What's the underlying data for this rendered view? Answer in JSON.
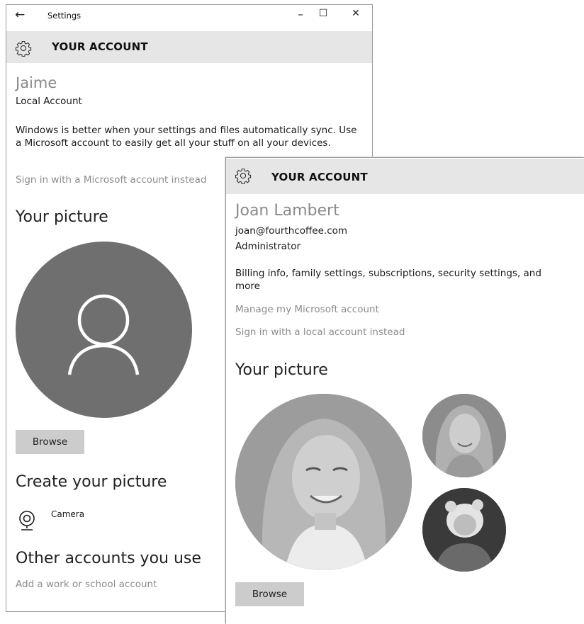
{
  "window1": {
    "app_title": "Settings",
    "back_glyph": "←",
    "minimize_glyph": "–",
    "maximize_glyph": "☐",
    "close_glyph": "✕",
    "header_title": "YOUR ACCOUNT",
    "user_name": "Jaime",
    "account_type": "Local Account",
    "sync_message": "Windows is better when your settings and files automatically sync. Use a Microsoft account to easily get all your stuff on all your devices.",
    "sign_in_link": "Sign in with a Microsoft account instead",
    "your_picture_heading": "Your picture",
    "browse_label": "Browse",
    "create_picture_heading": "Create your picture",
    "camera_label": "Camera",
    "other_accounts_heading": "Other accounts you use",
    "add_account_link": "Add a work or school account"
  },
  "window2": {
    "header_title": "YOUR ACCOUNT",
    "user_name": "Joan Lambert",
    "email": "joan@fourthcoffee.com",
    "role": "Administrator",
    "billing_text": "Billing info, family settings, subscriptions, security settings, and more",
    "manage_link": "Manage my Microsoft account",
    "local_link": "Sign in with a local account instead",
    "your_picture_heading": "Your picture",
    "browse_label": "Browse"
  },
  "icons": {
    "gear": "gear-icon",
    "user_silhouette": "user-silhouette-icon",
    "camera": "webcam-icon"
  },
  "colors": {
    "header_bg": "#e6e6e6",
    "avatar_bg": "#6f6f6f",
    "button_bg": "#cccccc",
    "link_text": "#8c8c8c"
  }
}
